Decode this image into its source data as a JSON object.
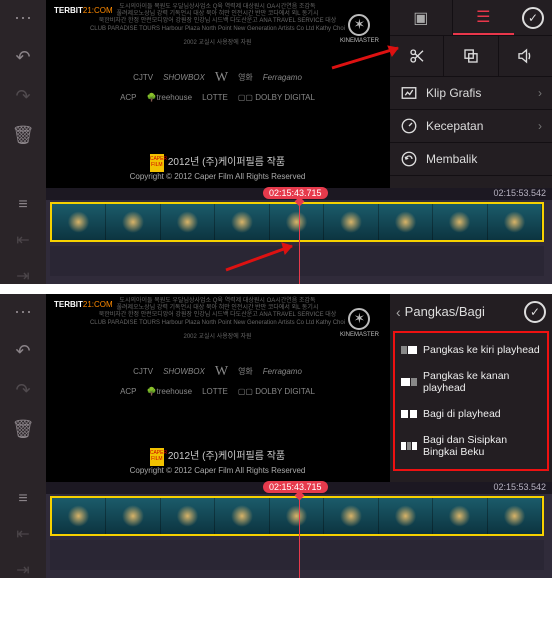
{
  "app": {
    "watermark": "KINEMASTER",
    "terbit_a": "TERBIT",
    "terbit_b": "21:COM"
  },
  "logos": [
    "CJTV",
    "SHOWBOX",
    "W",
    "영화",
    "Ferragamo",
    "ACP",
    "treehouse",
    "LOTTE",
    "DOLBY DIGITAL"
  ],
  "credit_year": "2012년 (주)케이퍼필름 작품",
  "credit_sub": "Copyright © 2012 Caper Film All Rights Reserved",
  "timeline": {
    "current": "02:15:43.715",
    "duration": "02:15:53.542"
  },
  "panel1": {
    "menu": [
      {
        "label": "Klip Grafis"
      },
      {
        "label": "Kecepatan"
      },
      {
        "label": "Membalik"
      }
    ]
  },
  "panel2": {
    "title": "Pangkas/Bagi",
    "items": [
      "Pangkas ke kiri playhead",
      "Pangkas ke kanan playhead",
      "Bagi di playhead",
      "Bagi dan Sisipkan Bingkai Beku"
    ]
  }
}
